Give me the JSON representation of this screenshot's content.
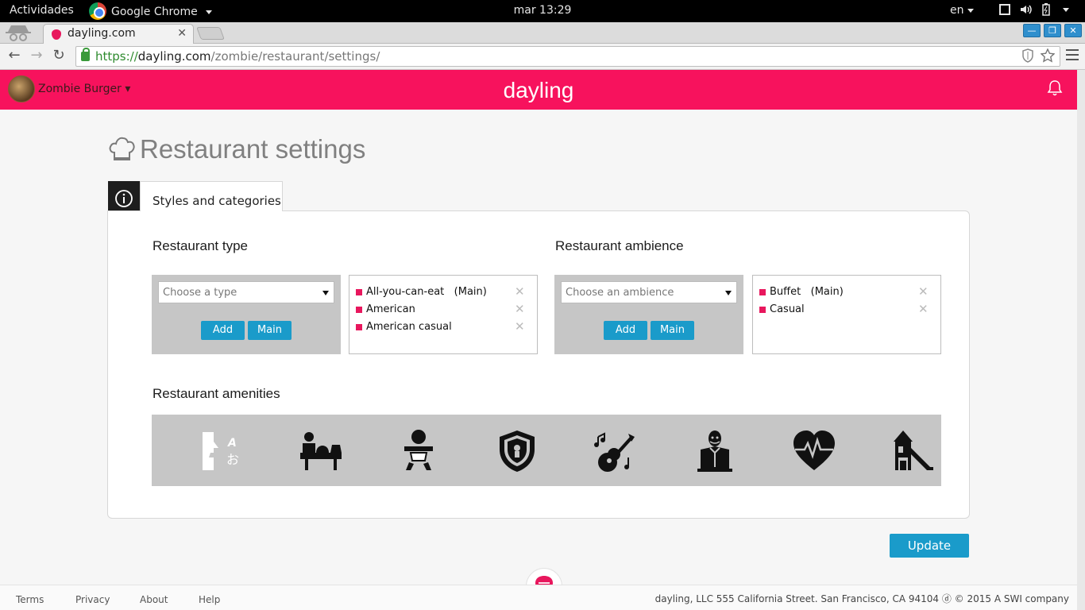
{
  "system": {
    "activities": "Actividades",
    "app_name": "Google Chrome",
    "clock": "mar 13:29",
    "lang": "en"
  },
  "browser": {
    "tab_title": "dayling.com",
    "url_scheme": "https://",
    "url_host": "dayling.com",
    "url_path": "/zombie/restaurant/settings/"
  },
  "header": {
    "restaurant_name": "Zombie Burger ▾",
    "logo": "dayling"
  },
  "page": {
    "title": "Restaurant settings",
    "active_tab": "Styles and categories"
  },
  "sidebar": {
    "items": [
      {
        "name": "info-icon",
        "active": false
      },
      {
        "name": "easel-icon",
        "active": true
      },
      {
        "name": "play-icon",
        "active": false
      },
      {
        "name": "calendar-icon",
        "active": false
      },
      {
        "name": "cloche-icon",
        "active": false
      }
    ]
  },
  "type_section": {
    "title": "Restaurant type",
    "placeholder": "Choose a type",
    "add_label": "Add",
    "main_label": "Main",
    "items": [
      {
        "label": "All-you-can-eat",
        "suffix": "(Main)"
      },
      {
        "label": "American",
        "suffix": ""
      },
      {
        "label": "American casual",
        "suffix": ""
      }
    ]
  },
  "ambience_section": {
    "title": "Restaurant ambience",
    "placeholder": "Choose an ambience",
    "add_label": "Add",
    "main_label": "Main",
    "items": [
      {
        "label": "Buffet",
        "suffix": "(Main)"
      },
      {
        "label": "Casual",
        "suffix": ""
      }
    ]
  },
  "amenities": {
    "title": "Restaurant amenities",
    "items": [
      "language-icon",
      "reception-desk-icon",
      "baby-icon",
      "security-badge-icon",
      "live-music-icon",
      "butler-icon",
      "heartbeat-icon",
      "playground-icon"
    ]
  },
  "actions": {
    "update_label": "Update"
  },
  "footer": {
    "terms": "Terms",
    "privacy": "Privacy",
    "about": "About",
    "help": "Help",
    "address": "dayling, LLC 555 California Street. San Francisco, CA 94104 ⓓ © 2015 A SWI company"
  },
  "colors": {
    "brand": "#f7125d",
    "accent": "#1a9bca",
    "tag_marker": "#e8175d"
  }
}
